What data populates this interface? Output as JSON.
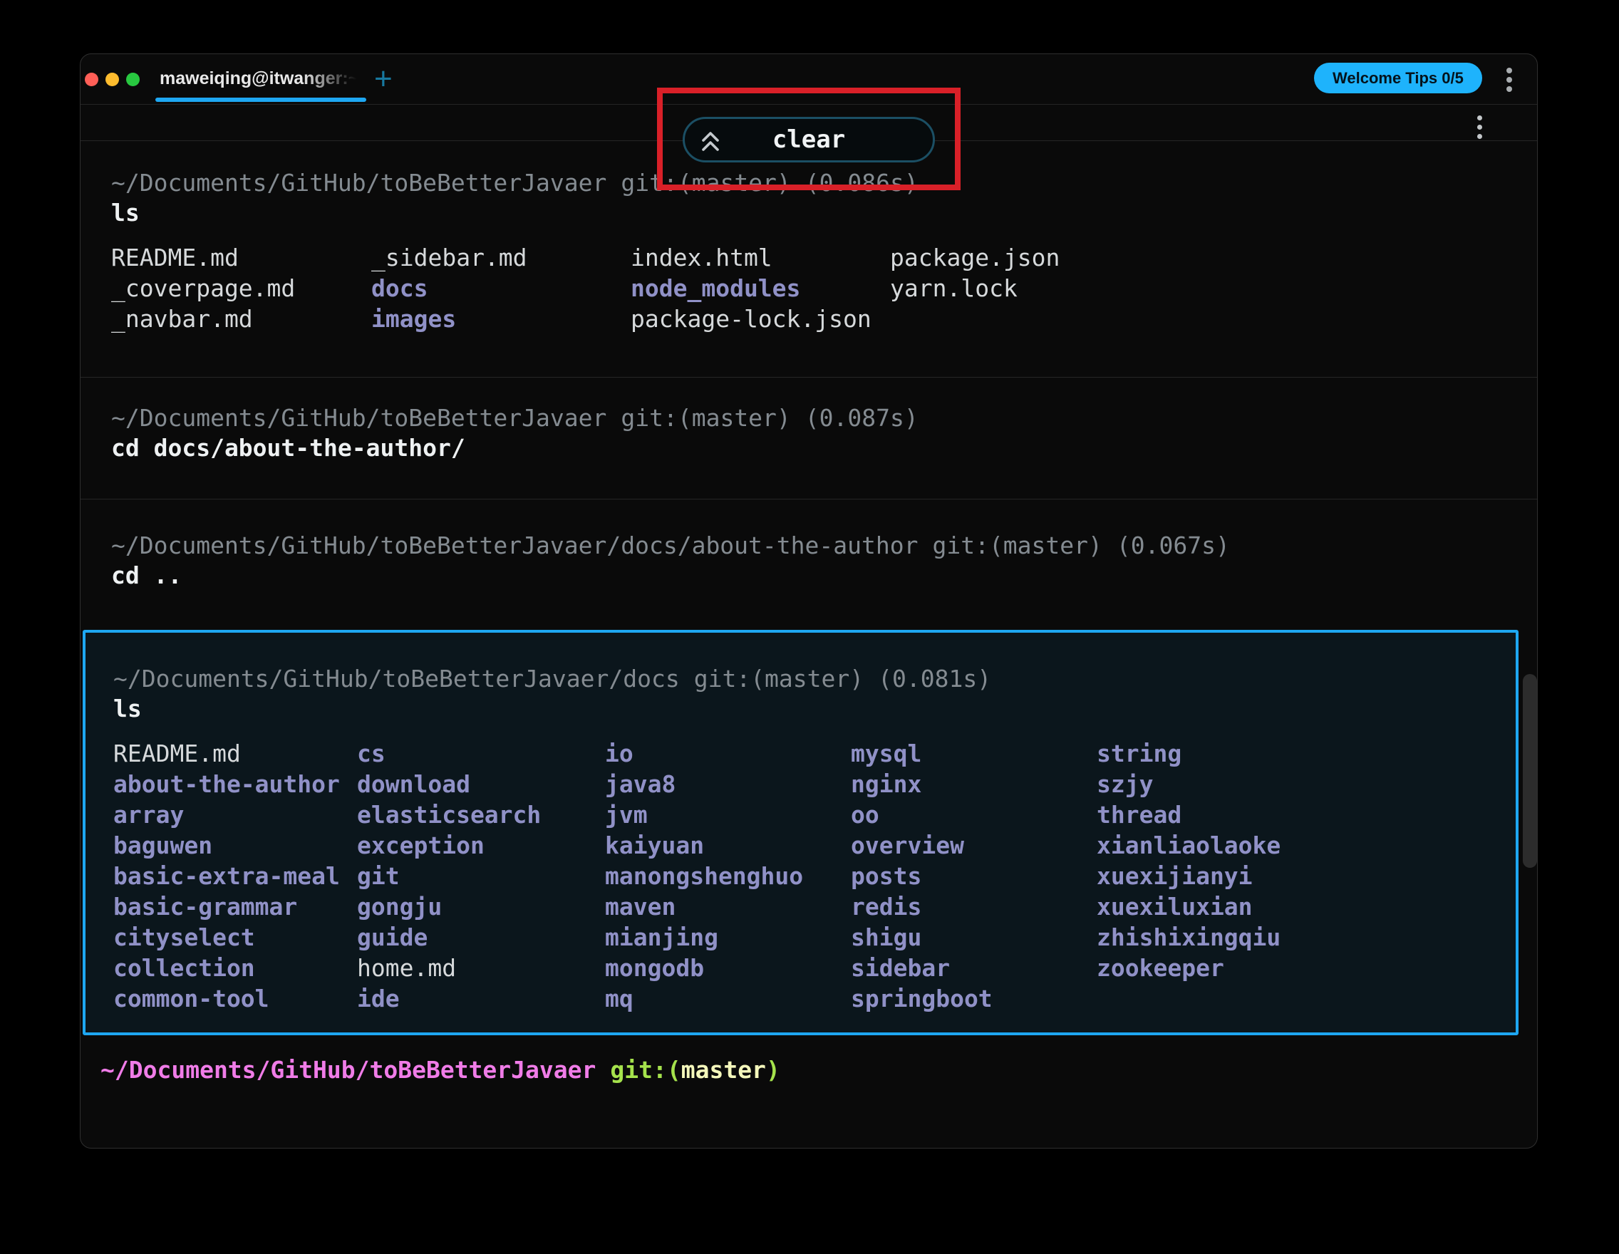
{
  "window": {
    "tab": {
      "title": "maweiqing@itwanger:~/Docum"
    },
    "new_tab_label": "+",
    "welcome_tips_label": "Welcome Tips 0/5"
  },
  "annotation": {
    "popup_label": "clear"
  },
  "blocks": [
    {
      "path": "~/Documents/GitHub/toBeBetterJavaer",
      "git": "git:(master)",
      "duration": "(0.086s)",
      "command": "ls",
      "listing": [
        [
          {
            "t": "README.md",
            "k": "file"
          },
          {
            "t": "_sidebar.md",
            "k": "file"
          },
          {
            "t": "index.html",
            "k": "file"
          },
          {
            "t": "package.json",
            "k": "file"
          }
        ],
        [
          {
            "t": "_coverpage.md",
            "k": "file"
          },
          {
            "t": "docs",
            "k": "dir"
          },
          {
            "t": "node_modules",
            "k": "dir"
          },
          {
            "t": "yarn.lock",
            "k": "file"
          }
        ],
        [
          {
            "t": "_navbar.md",
            "k": "file"
          },
          {
            "t": "images",
            "k": "dir"
          },
          {
            "t": "package-lock.json",
            "k": "file"
          }
        ]
      ]
    },
    {
      "path": "~/Documents/GitHub/toBeBetterJavaer",
      "git": "git:(master)",
      "duration": "(0.087s)",
      "command": "cd docs/about-the-author/"
    },
    {
      "path": "~/Documents/GitHub/toBeBetterJavaer/docs/about-the-author",
      "git": "git:(master)",
      "duration": "(0.067s)",
      "command": "cd .."
    },
    {
      "path": "~/Documents/GitHub/toBeBetterJavaer/docs",
      "git": "git:(master)",
      "duration": "(0.081s)",
      "command": "ls",
      "listing": [
        [
          {
            "t": "README.md",
            "k": "file"
          },
          {
            "t": "cs",
            "k": "dir"
          },
          {
            "t": "io",
            "k": "dir"
          },
          {
            "t": "mysql",
            "k": "dir"
          },
          {
            "t": "string",
            "k": "dir"
          }
        ],
        [
          {
            "t": "about-the-author",
            "k": "dir"
          },
          {
            "t": "download",
            "k": "dir"
          },
          {
            "t": "java8",
            "k": "dir"
          },
          {
            "t": "nginx",
            "k": "dir"
          },
          {
            "t": "szjy",
            "k": "dir"
          }
        ],
        [
          {
            "t": "array",
            "k": "dir"
          },
          {
            "t": "elasticsearch",
            "k": "dir"
          },
          {
            "t": "jvm",
            "k": "dir"
          },
          {
            "t": "oo",
            "k": "dir"
          },
          {
            "t": "thread",
            "k": "dir"
          }
        ],
        [
          {
            "t": "baguwen",
            "k": "dir"
          },
          {
            "t": "exception",
            "k": "dir"
          },
          {
            "t": "kaiyuan",
            "k": "dir"
          },
          {
            "t": "overview",
            "k": "dir"
          },
          {
            "t": "xianliaolaoke",
            "k": "dir"
          }
        ],
        [
          {
            "t": "basic-extra-meal",
            "k": "dir"
          },
          {
            "t": "git",
            "k": "dir"
          },
          {
            "t": "manongshenghuo",
            "k": "dir"
          },
          {
            "t": "posts",
            "k": "dir"
          },
          {
            "t": "xuexijianyi",
            "k": "dir"
          }
        ],
        [
          {
            "t": "basic-grammar",
            "k": "dir"
          },
          {
            "t": "gongju",
            "k": "dir"
          },
          {
            "t": "maven",
            "k": "dir"
          },
          {
            "t": "redis",
            "k": "dir"
          },
          {
            "t": "xuexiluxian",
            "k": "dir"
          }
        ],
        [
          {
            "t": "cityselect",
            "k": "dir"
          },
          {
            "t": "guide",
            "k": "dir"
          },
          {
            "t": "mianjing",
            "k": "dir"
          },
          {
            "t": "shigu",
            "k": "dir"
          },
          {
            "t": "zhishixingqiu",
            "k": "dir"
          }
        ],
        [
          {
            "t": "collection",
            "k": "dir"
          },
          {
            "t": "home.md",
            "k": "file"
          },
          {
            "t": "mongodb",
            "k": "dir"
          },
          {
            "t": "sidebar",
            "k": "dir"
          },
          {
            "t": "zookeeper",
            "k": "dir"
          }
        ],
        [
          {
            "t": "common-tool",
            "k": "dir"
          },
          {
            "t": "ide",
            "k": "dir"
          },
          {
            "t": "mq",
            "k": "dir"
          },
          {
            "t": "springboot",
            "k": "dir"
          }
        ]
      ]
    }
  ],
  "prompt": {
    "path": "~/Documents/GitHub/toBeBetterJavaer",
    "git_open": "git:(",
    "branch": "master",
    "git_close": ")"
  },
  "colors": {
    "accent": "#1ea7f2",
    "annotation-red": "#d92028",
    "dir": "#9091c7",
    "file": "#d6d9db",
    "cmd": "#eef1f2",
    "hdr": "#848b91",
    "block-bg": "#0b161c",
    "popup-border": "#1b4f64",
    "prompt-pink": "#f07ce8",
    "prompt-green": "#a5e24c",
    "prompt-branch": "#f4f7bb",
    "traffic-red": "#ff5f57",
    "traffic-yellow": "#febc2e",
    "traffic-green": "#28c840"
  }
}
